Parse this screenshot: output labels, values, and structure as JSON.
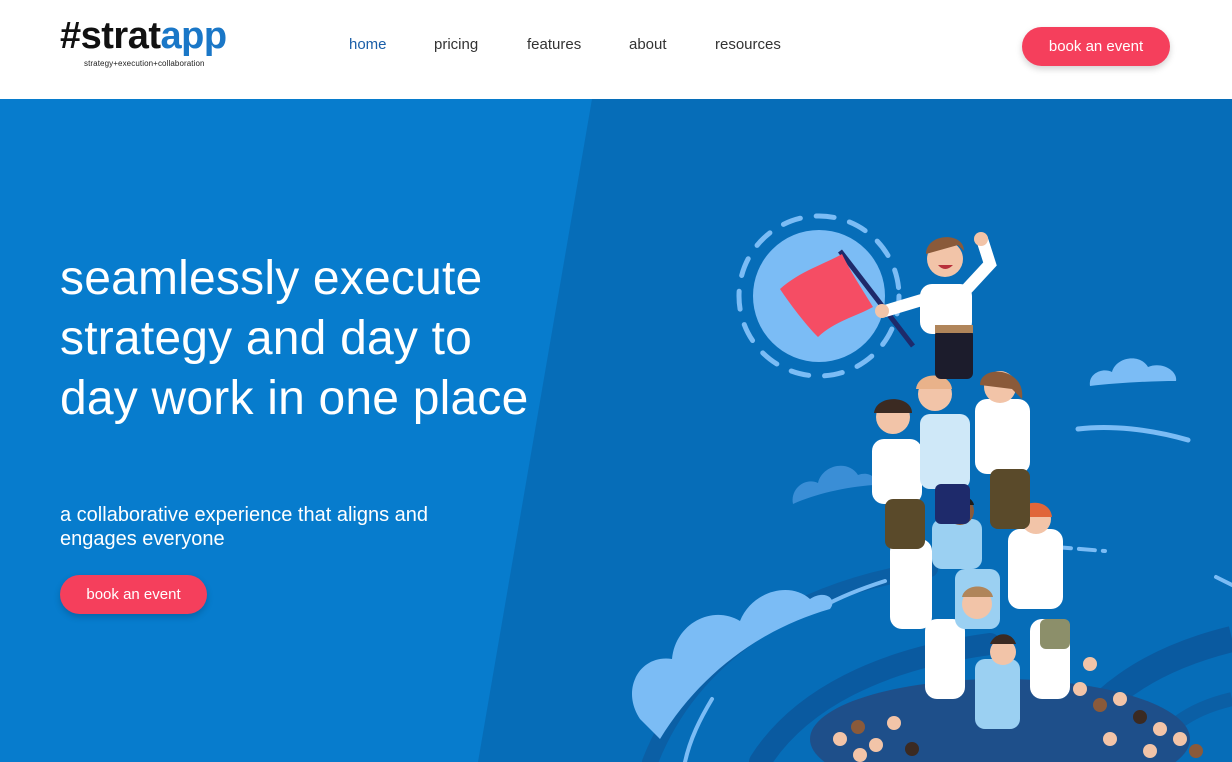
{
  "brand": {
    "hash": "#strat",
    "app": "app",
    "tagline": "strategy+execution+collaboration"
  },
  "nav": {
    "items": [
      {
        "label": "home",
        "active": true
      },
      {
        "label": "pricing"
      },
      {
        "label": "features"
      },
      {
        "label": "about"
      },
      {
        "label": "resources"
      }
    ]
  },
  "header": {
    "cta_label": "book an event"
  },
  "hero": {
    "headline": "seamlessly execute strategy and day to day work in one place",
    "subline": "a collaborative experience that aligns and engages everyone",
    "cta_label": "book an event",
    "illustration": "team-pyramid-flag-illustration"
  },
  "colors": {
    "brand_blue": "#1a77c7",
    "hero_bg": "#066db8",
    "hero_panel": "#077ccd",
    "cta": "#f53f5c",
    "flag": "#f54d64"
  }
}
